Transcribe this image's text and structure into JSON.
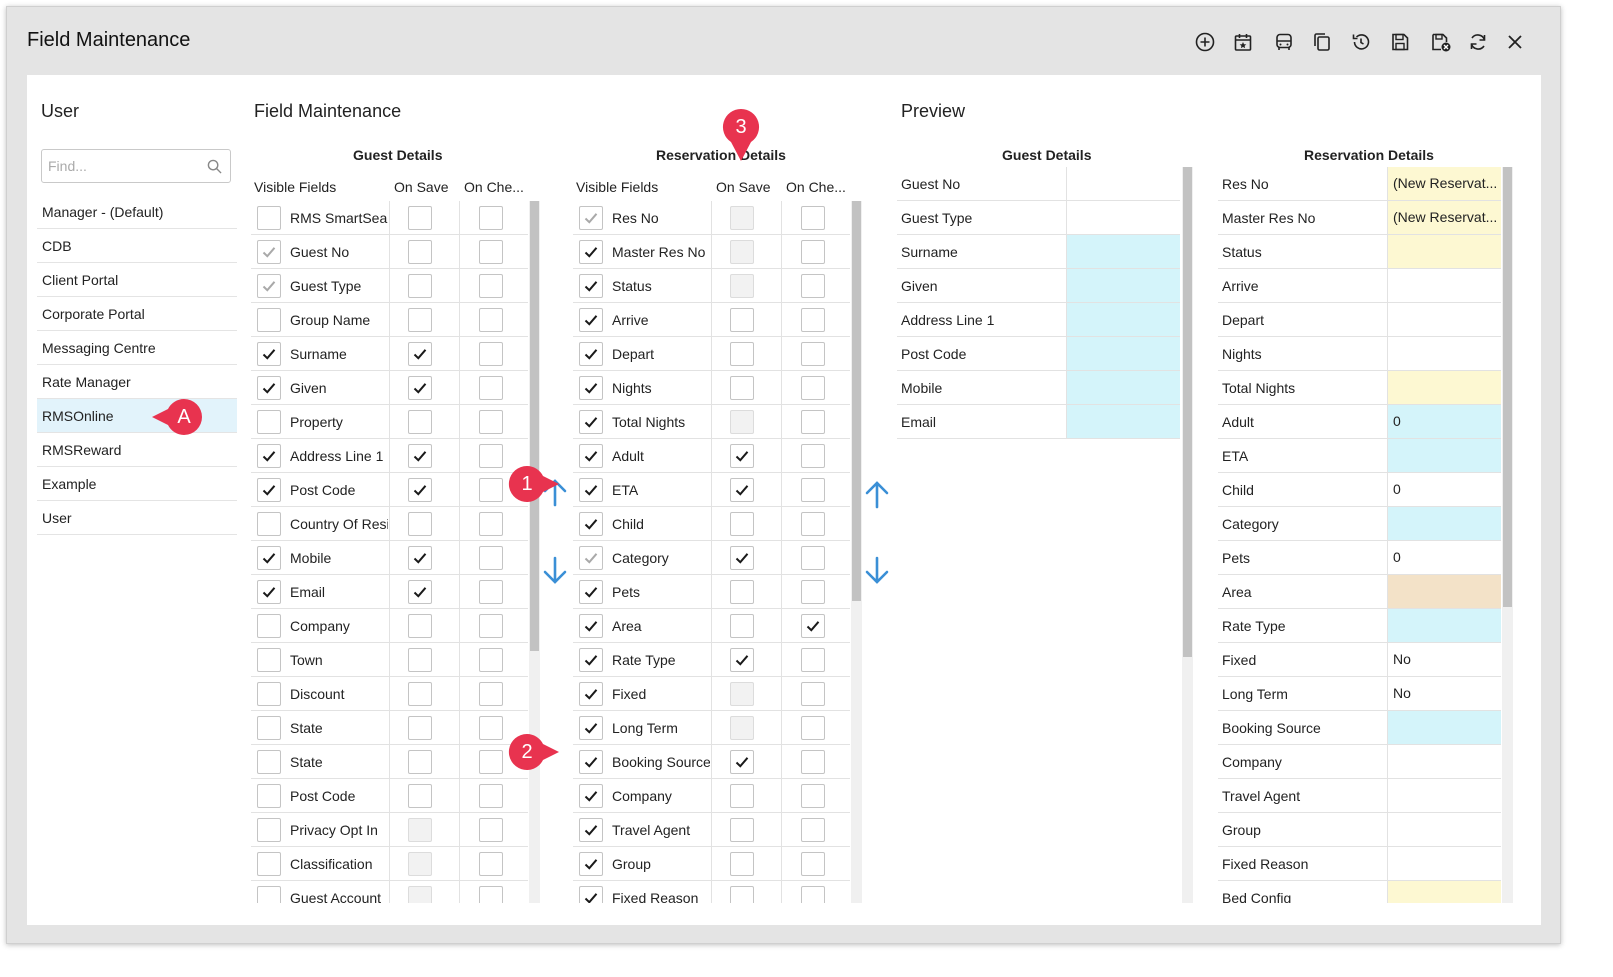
{
  "window": {
    "title": "Field Maintenance"
  },
  "toolbar": [
    "add-icon",
    "calendar-icon",
    "bus-icon",
    "copy-icon",
    "history-icon",
    "save-icon",
    "save-close-icon",
    "refresh-icon",
    "close-icon"
  ],
  "user_panel": {
    "title": "User",
    "search_placeholder": "Find...",
    "items": [
      "Manager - (Default)",
      "CDB",
      "Client Portal",
      "Corporate Portal",
      "Messaging Centre",
      "Rate Manager",
      "RMSOnline",
      "RMSReward",
      "Example",
      "User"
    ],
    "selected": "RMSOnline"
  },
  "field_maintenance": {
    "title": "Field Maintenance",
    "guest_details": {
      "title": "Guest Details",
      "columns": [
        "Visible Fields",
        "On Save",
        "On Che..."
      ],
      "rows": [
        {
          "label": "RMS SmartSearch",
          "visible": "off",
          "on_save": "off",
          "on_checkin": "off"
        },
        {
          "label": "Guest No",
          "visible": "locked",
          "on_save": "off",
          "on_checkin": "off"
        },
        {
          "label": "Guest Type",
          "visible": "locked",
          "on_save": "off",
          "on_checkin": "off"
        },
        {
          "label": "Group Name",
          "visible": "off",
          "on_save": "off",
          "on_checkin": "off"
        },
        {
          "label": "Surname",
          "visible": "on",
          "on_save": "on",
          "on_checkin": "off"
        },
        {
          "label": "Given",
          "visible": "on",
          "on_save": "on",
          "on_checkin": "off"
        },
        {
          "label": "Property",
          "visible": "off",
          "on_save": "off",
          "on_checkin": "off"
        },
        {
          "label": "Address Line 1",
          "visible": "on",
          "on_save": "on",
          "on_checkin": "off"
        },
        {
          "label": "Post Code",
          "visible": "on",
          "on_save": "on",
          "on_checkin": "off"
        },
        {
          "label": "Country Of Residence",
          "visible": "off",
          "on_save": "off",
          "on_checkin": "off"
        },
        {
          "label": "Mobile",
          "visible": "on",
          "on_save": "on",
          "on_checkin": "off"
        },
        {
          "label": "Email",
          "visible": "on",
          "on_save": "on",
          "on_checkin": "off"
        },
        {
          "label": "Company",
          "visible": "off",
          "on_save": "off",
          "on_checkin": "off"
        },
        {
          "label": "Town",
          "visible": "off",
          "on_save": "off",
          "on_checkin": "off"
        },
        {
          "label": "Discount",
          "visible": "off",
          "on_save": "off",
          "on_checkin": "off"
        },
        {
          "label": "State",
          "visible": "off",
          "on_save": "off",
          "on_checkin": "off"
        },
        {
          "label": "State",
          "visible": "off",
          "on_save": "off",
          "on_checkin": "off"
        },
        {
          "label": "Post Code",
          "visible": "off",
          "on_save": "off",
          "on_checkin": "off"
        },
        {
          "label": "Privacy Opt In",
          "visible": "off",
          "on_save": "disabled",
          "on_checkin": "off"
        },
        {
          "label": "Classification",
          "visible": "off",
          "on_save": "disabled",
          "on_checkin": "off"
        },
        {
          "label": "Guest Account",
          "visible": "off",
          "on_save": "disabled",
          "on_checkin": "off"
        }
      ]
    },
    "reservation_details": {
      "title": "Reservation Details",
      "columns": [
        "Visible Fields",
        "On Save",
        "On Che..."
      ],
      "rows": [
        {
          "label": "Res No",
          "visible": "locked",
          "on_save": "disabled",
          "on_checkin": "off"
        },
        {
          "label": "Master Res No",
          "visible": "on",
          "on_save": "disabled",
          "on_checkin": "off"
        },
        {
          "label": "Status",
          "visible": "on",
          "on_save": "disabled",
          "on_checkin": "off"
        },
        {
          "label": "Arrive",
          "visible": "on",
          "on_save": "off",
          "on_checkin": "off"
        },
        {
          "label": "Depart",
          "visible": "on",
          "on_save": "off",
          "on_checkin": "off"
        },
        {
          "label": "Nights",
          "visible": "on",
          "on_save": "off",
          "on_checkin": "off"
        },
        {
          "label": "Total Nights",
          "visible": "on",
          "on_save": "disabled",
          "on_checkin": "off"
        },
        {
          "label": "Adult",
          "visible": "on",
          "on_save": "on",
          "on_checkin": "off"
        },
        {
          "label": "ETA",
          "visible": "on",
          "on_save": "on",
          "on_checkin": "off"
        },
        {
          "label": "Child",
          "visible": "on",
          "on_save": "off",
          "on_checkin": "off"
        },
        {
          "label": "Category",
          "visible": "locked",
          "on_save": "on",
          "on_checkin": "off"
        },
        {
          "label": "Pets",
          "visible": "on",
          "on_save": "off",
          "on_checkin": "off"
        },
        {
          "label": "Area",
          "visible": "on",
          "on_save": "off",
          "on_checkin": "on"
        },
        {
          "label": "Rate Type",
          "visible": "on",
          "on_save": "on",
          "on_checkin": "off"
        },
        {
          "label": "Fixed",
          "visible": "on",
          "on_save": "disabled",
          "on_checkin": "off"
        },
        {
          "label": "Long Term",
          "visible": "on",
          "on_save": "disabled",
          "on_checkin": "off"
        },
        {
          "label": "Booking Source",
          "visible": "on",
          "on_save": "on",
          "on_checkin": "off"
        },
        {
          "label": "Company",
          "visible": "on",
          "on_save": "off",
          "on_checkin": "off"
        },
        {
          "label": "Travel Agent",
          "visible": "on",
          "on_save": "off",
          "on_checkin": "off"
        },
        {
          "label": "Group",
          "visible": "on",
          "on_save": "off",
          "on_checkin": "off"
        },
        {
          "label": "Fixed Reason",
          "visible": "on",
          "on_save": "off",
          "on_checkin": "off"
        }
      ]
    }
  },
  "preview": {
    "title": "Preview",
    "guest_details": {
      "title": "Guest Details",
      "rows": [
        {
          "label": "Guest No",
          "value": "",
          "color": "#ffffff"
        },
        {
          "label": "Guest Type",
          "value": "",
          "color": "#ffffff"
        },
        {
          "label": "Surname",
          "value": "",
          "color": "#d4f4fa"
        },
        {
          "label": "Given",
          "value": "",
          "color": "#d4f4fa"
        },
        {
          "label": "Address Line 1",
          "value": "",
          "color": "#d4f4fa"
        },
        {
          "label": "Post Code",
          "value": "",
          "color": "#d4f4fa"
        },
        {
          "label": "Mobile",
          "value": "",
          "color": "#d4f4fa"
        },
        {
          "label": "Email",
          "value": "",
          "color": "#d4f4fa"
        }
      ]
    },
    "reservation_details": {
      "title": "Reservation Details",
      "rows": [
        {
          "label": "Res No",
          "value": "(New Reservat...",
          "color": "#fdf8d2"
        },
        {
          "label": "Master Res No",
          "value": "(New Reservat...",
          "color": "#fdf8d2"
        },
        {
          "label": "Status",
          "value": "",
          "color": "#fdf8d2"
        },
        {
          "label": "Arrive",
          "value": "",
          "color": "#ffffff"
        },
        {
          "label": "Depart",
          "value": "",
          "color": "#ffffff"
        },
        {
          "label": "Nights",
          "value": "",
          "color": "#ffffff"
        },
        {
          "label": "Total Nights",
          "value": "",
          "color": "#fdf8d2"
        },
        {
          "label": "Adult",
          "value": "0",
          "color": "#d4f4fa"
        },
        {
          "label": "ETA",
          "value": "",
          "color": "#d4f4fa"
        },
        {
          "label": "Child",
          "value": "0",
          "color": "#ffffff"
        },
        {
          "label": "Category",
          "value": "",
          "color": "#d4f4fa"
        },
        {
          "label": "Pets",
          "value": "0",
          "color": "#ffffff"
        },
        {
          "label": "Area",
          "value": "",
          "color": "#f3e2c8"
        },
        {
          "label": "Rate Type",
          "value": "",
          "color": "#d4f4fa"
        },
        {
          "label": "Fixed",
          "value": "No",
          "color": "#ffffff"
        },
        {
          "label": "Long Term",
          "value": "No",
          "color": "#ffffff"
        },
        {
          "label": "Booking Source",
          "value": "",
          "color": "#d4f4fa"
        },
        {
          "label": "Company",
          "value": "",
          "color": "#ffffff"
        },
        {
          "label": "Travel Agent",
          "value": "",
          "color": "#ffffff"
        },
        {
          "label": "Group",
          "value": "",
          "color": "#ffffff"
        },
        {
          "label": "Fixed Reason",
          "value": "",
          "color": "#ffffff"
        },
        {
          "label": "Bed Config",
          "value": "",
          "color": "#fdf8d2"
        }
      ]
    }
  },
  "callouts": [
    "A",
    "1",
    "2",
    "3"
  ],
  "colors": {
    "callout": "#e8334f",
    "arrow": "#3a8fd6",
    "selected_row": "#e2f3fb"
  }
}
